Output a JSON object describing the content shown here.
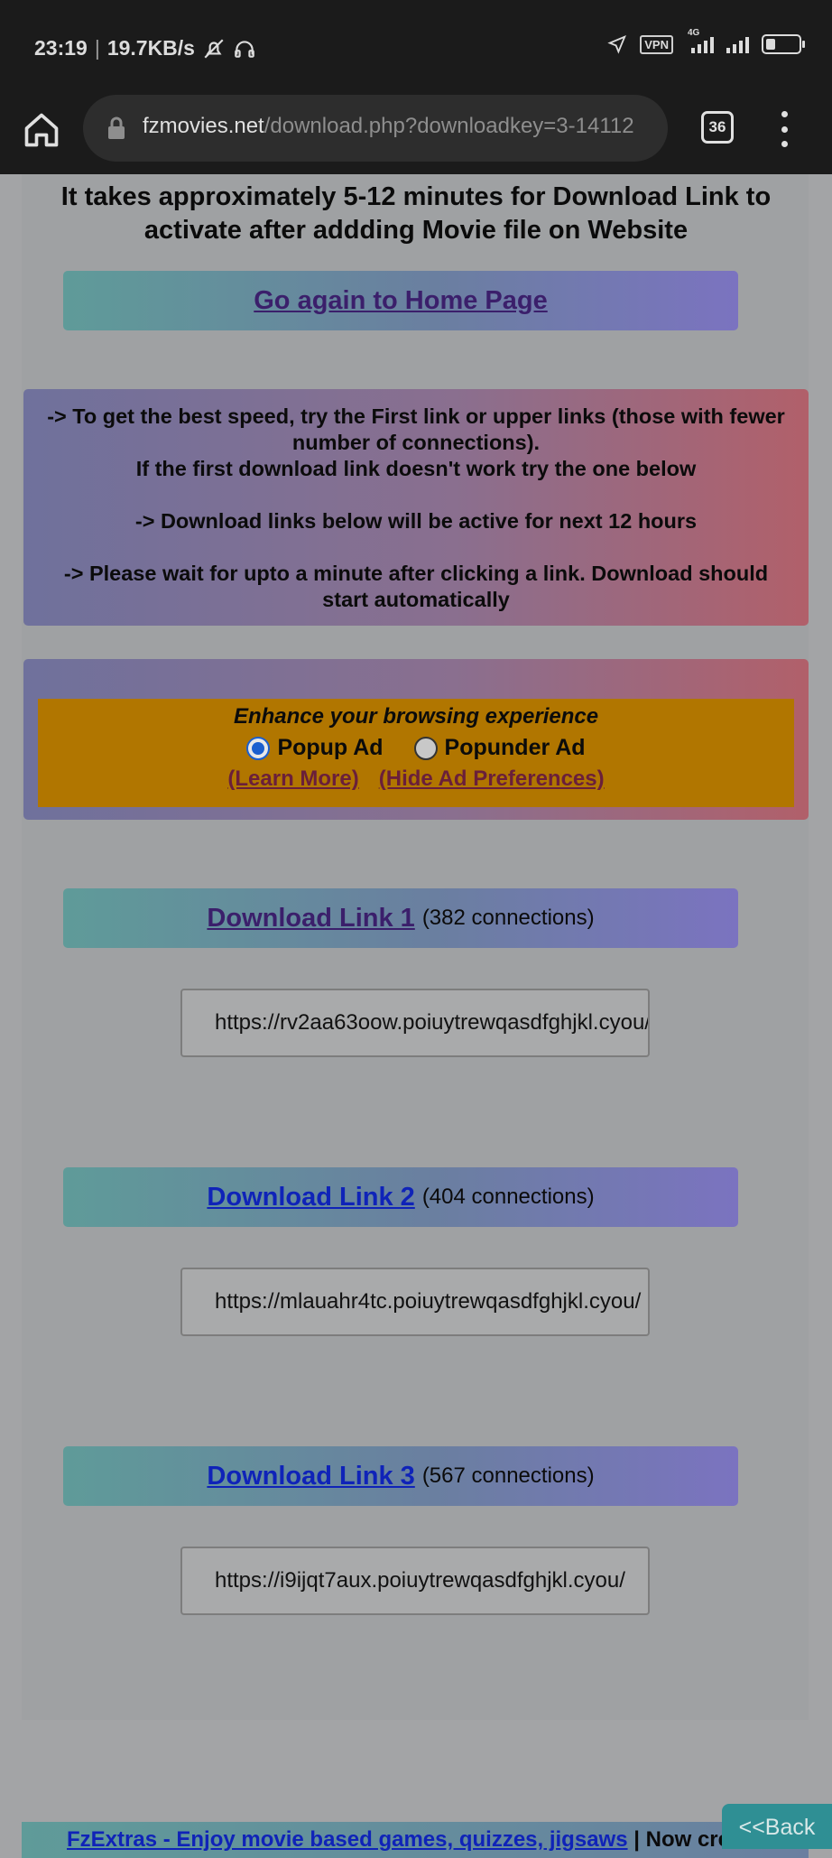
{
  "status_bar": {
    "time": "23:19",
    "net_speed": "19.7KB/s",
    "vpn_label": "VPN",
    "network_type": "4G"
  },
  "browser": {
    "url_host": "fzmovies.net",
    "url_path": "/download.php?downloadkey=3-14112",
    "tab_count": "36"
  },
  "page": {
    "headline": "It takes approximately 5-12 minutes for Download Link to activate after addding Movie file on Website",
    "home_link": "Go again to Home Page",
    "info": {
      "line1": "-> To get the best speed, try the First link or upper links (those with fewer number of connections).",
      "line2": "If the first download link doesn't work try the one below",
      "line3": "-> Download links below will be active for next 12 hours",
      "line4": "-> Please wait for upto a minute after clicking a link. Download should start automatically"
    },
    "ad_prefs": {
      "title": "Enhance your browsing experience",
      "option1": "Popup Ad",
      "option2": "Popunder Ad",
      "selected": "Popup Ad",
      "learn_more": "(Learn More)",
      "hide": "(Hide Ad Preferences)"
    },
    "downloads": [
      {
        "label": "Download Link 1",
        "connections": "(382 connections)",
        "url": "https://rv2aa63oow.poiuytrewqasdfghjkl.cyou/"
      },
      {
        "label": "Download Link 2",
        "connections": "(404 connections)",
        "url": "https://mlauahr4tc.poiuytrewqasdfghjkl.cyou/"
      },
      {
        "label": "Download Link 3",
        "connections": "(567 connections)",
        "url": "https://i9ijqt7aux.poiuytrewqasdfghjkl.cyou/"
      }
    ],
    "footer": {
      "link": "FzExtras - Enjoy movie based games, quizzes, jigsaws",
      "separator": " | ",
      "rest": "Now crea"
    },
    "back_button": "<<Back"
  }
}
